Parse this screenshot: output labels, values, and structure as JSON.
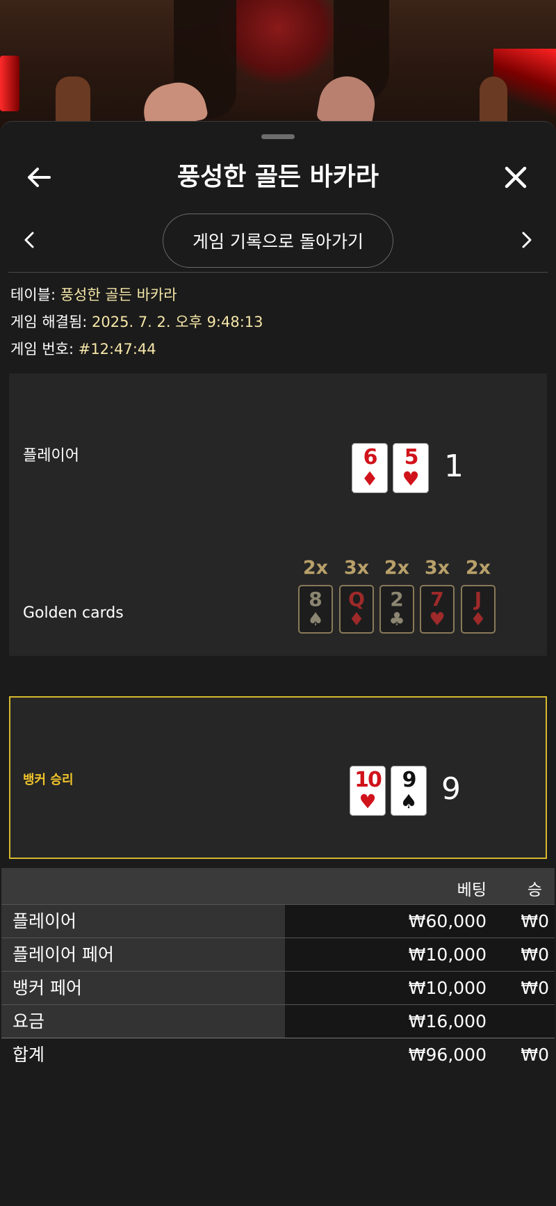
{
  "header": {
    "title": "풍성한 골든 바카라",
    "back_icon": "arrow-left-icon",
    "close_icon": "close-icon"
  },
  "nav": {
    "back_to_history_label": "게임 기록으로 돌아가기",
    "prev_icon": "chevron-left-icon",
    "next_icon": "chevron-right-icon"
  },
  "info": {
    "table_key": "테이블: ",
    "table_value": "풍성한 골든 바카라",
    "resolved_key": "게임 해결됨: ",
    "resolved_value": "2025. 7. 2. 오후 9:48:13",
    "game_no_key": "게임 번호: ",
    "game_no_value": "#12:47:44"
  },
  "player": {
    "label": "플레이어",
    "score": "1",
    "cards": [
      {
        "rank": "6",
        "suit": "♦",
        "color": "red"
      },
      {
        "rank": "5",
        "suit": "♥",
        "color": "red"
      }
    ]
  },
  "golden": {
    "label": "Golden cards",
    "cards": [
      {
        "mult": "2x",
        "rank": "8",
        "suit": "♠",
        "color": "gray"
      },
      {
        "mult": "3x",
        "rank": "Q",
        "suit": "♦",
        "color": "red"
      },
      {
        "mult": "2x",
        "rank": "2",
        "suit": "♣",
        "color": "gray"
      },
      {
        "mult": "3x",
        "rank": "7",
        "suit": "♥",
        "color": "red"
      },
      {
        "mult": "2x",
        "rank": "J",
        "suit": "♦",
        "color": "red"
      }
    ]
  },
  "banker": {
    "label": "뱅커 승리",
    "score": "9",
    "cards": [
      {
        "rank": "10",
        "suit": "♥",
        "color": "red"
      },
      {
        "rank": "9",
        "suit": "♠",
        "color": "black"
      }
    ]
  },
  "bets": {
    "col_bet": "베팅",
    "col_win": "승",
    "rows": [
      {
        "name": "플레이어",
        "bet": "₩60,000",
        "win": "₩0"
      },
      {
        "name": "플레이어 페어",
        "bet": "₩10,000",
        "win": "₩0"
      },
      {
        "name": "뱅커 페어",
        "bet": "₩10,000",
        "win": "₩0"
      },
      {
        "name": "요금",
        "bet": "₩16,000",
        "win": ""
      }
    ],
    "total": {
      "name": "합계",
      "bet": "₩96,000",
      "win": "₩0"
    }
  },
  "colors": {
    "accent_gold": "#d7b82e",
    "info_value": "#f5e6a8",
    "card_red": "#d0121b"
  }
}
